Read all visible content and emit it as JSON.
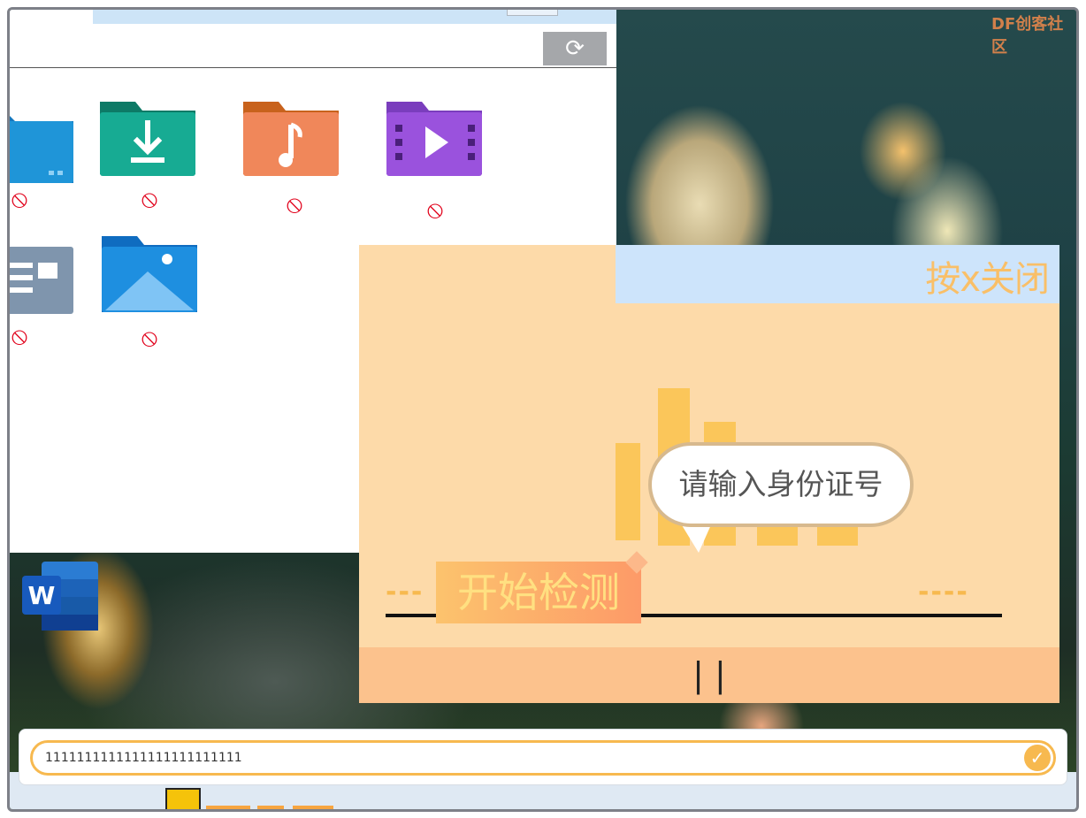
{
  "watermark": "DF创客社区",
  "explorer": {
    "refresh_icon": "⟳",
    "folders_row1": [
      {
        "name": "desktop-folder",
        "color": "#1f95d8"
      },
      {
        "name": "downloads-folder",
        "color": "#16a890"
      },
      {
        "name": "music-folder",
        "color": "#f08a4b"
      },
      {
        "name": "videos-folder",
        "color": "#9a52dd"
      }
    ],
    "folders_row2": [
      {
        "name": "documents-folder",
        "color": "#7f95ad"
      },
      {
        "name": "pictures-folder",
        "color": "#1e8fe0"
      }
    ],
    "blocked_symbol": "⃠"
  },
  "dialog": {
    "close_hint": "按x关闭",
    "bubble_text": "请输入身份证号",
    "start_button": "开始检测",
    "dash_left": "---",
    "dash_right": "----",
    "footer_text": "| |"
  },
  "input": {
    "value": "1111111111111111111111111",
    "confirm_icon": "✓"
  },
  "colors": {
    "accent": "#f7b94f",
    "dialog_bg": "#fddaa9",
    "dialog_header": "#cde4fb",
    "footer": "#fcc28d"
  }
}
